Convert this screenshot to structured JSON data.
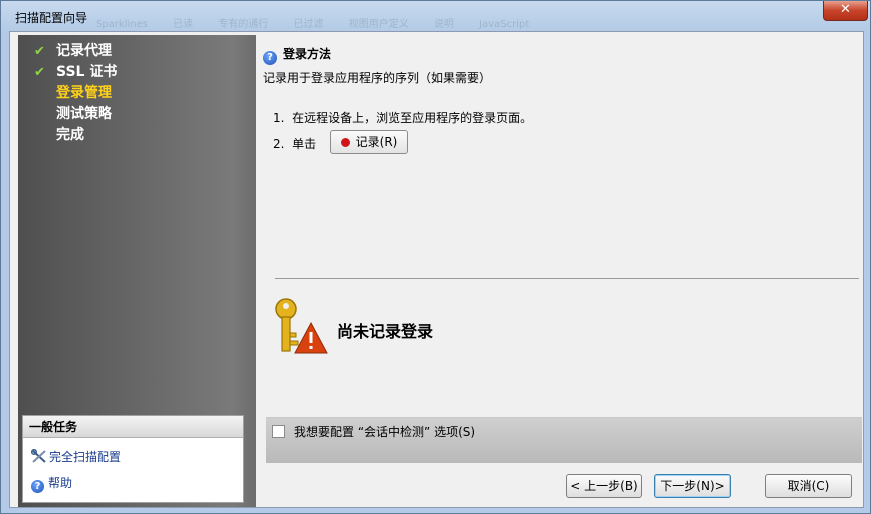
{
  "window": {
    "title": "扫描配置向导",
    "close_label": "✕",
    "ghost_tabs": [
      "Sparklines",
      "已读",
      "专有的通行",
      "已过滤",
      "视图用户定义",
      "说明",
      "JavaScript"
    ]
  },
  "wizard_steps": [
    {
      "label": "记录代理",
      "done": true
    },
    {
      "label": "SSL 证书",
      "done": true
    },
    {
      "label": "登录管理",
      "done": false,
      "current": true
    },
    {
      "label": "测试策略",
      "done": false
    },
    {
      "label": "完成",
      "done": false
    }
  ],
  "tasks": {
    "header": "一般任务",
    "items": [
      {
        "label": "完全扫描配置",
        "icon": "tools-icon"
      },
      {
        "label": "帮助",
        "icon": "help-icon"
      }
    ]
  },
  "content": {
    "heading": "登录方法",
    "description": "记录用于登录应用程序的序列（如果需要）",
    "step1_num": "1.",
    "step1_text": "在远程设备上，浏览至应用程序的登录页面。",
    "step2_num": "2.",
    "step2_text": "单击",
    "record_button": "记录(R)",
    "status": "尚未记录登录",
    "option_label": "我想要配置 “会话中检测” 选项(S)",
    "option_checked": false
  },
  "buttons": {
    "back": "< 上一步(B)",
    "next": "下一步(N)>",
    "cancel": "取消(C)"
  },
  "colors": {
    "current_step": "#ffd21a",
    "check": "#8fd448",
    "record_dot": "#d0141b"
  }
}
